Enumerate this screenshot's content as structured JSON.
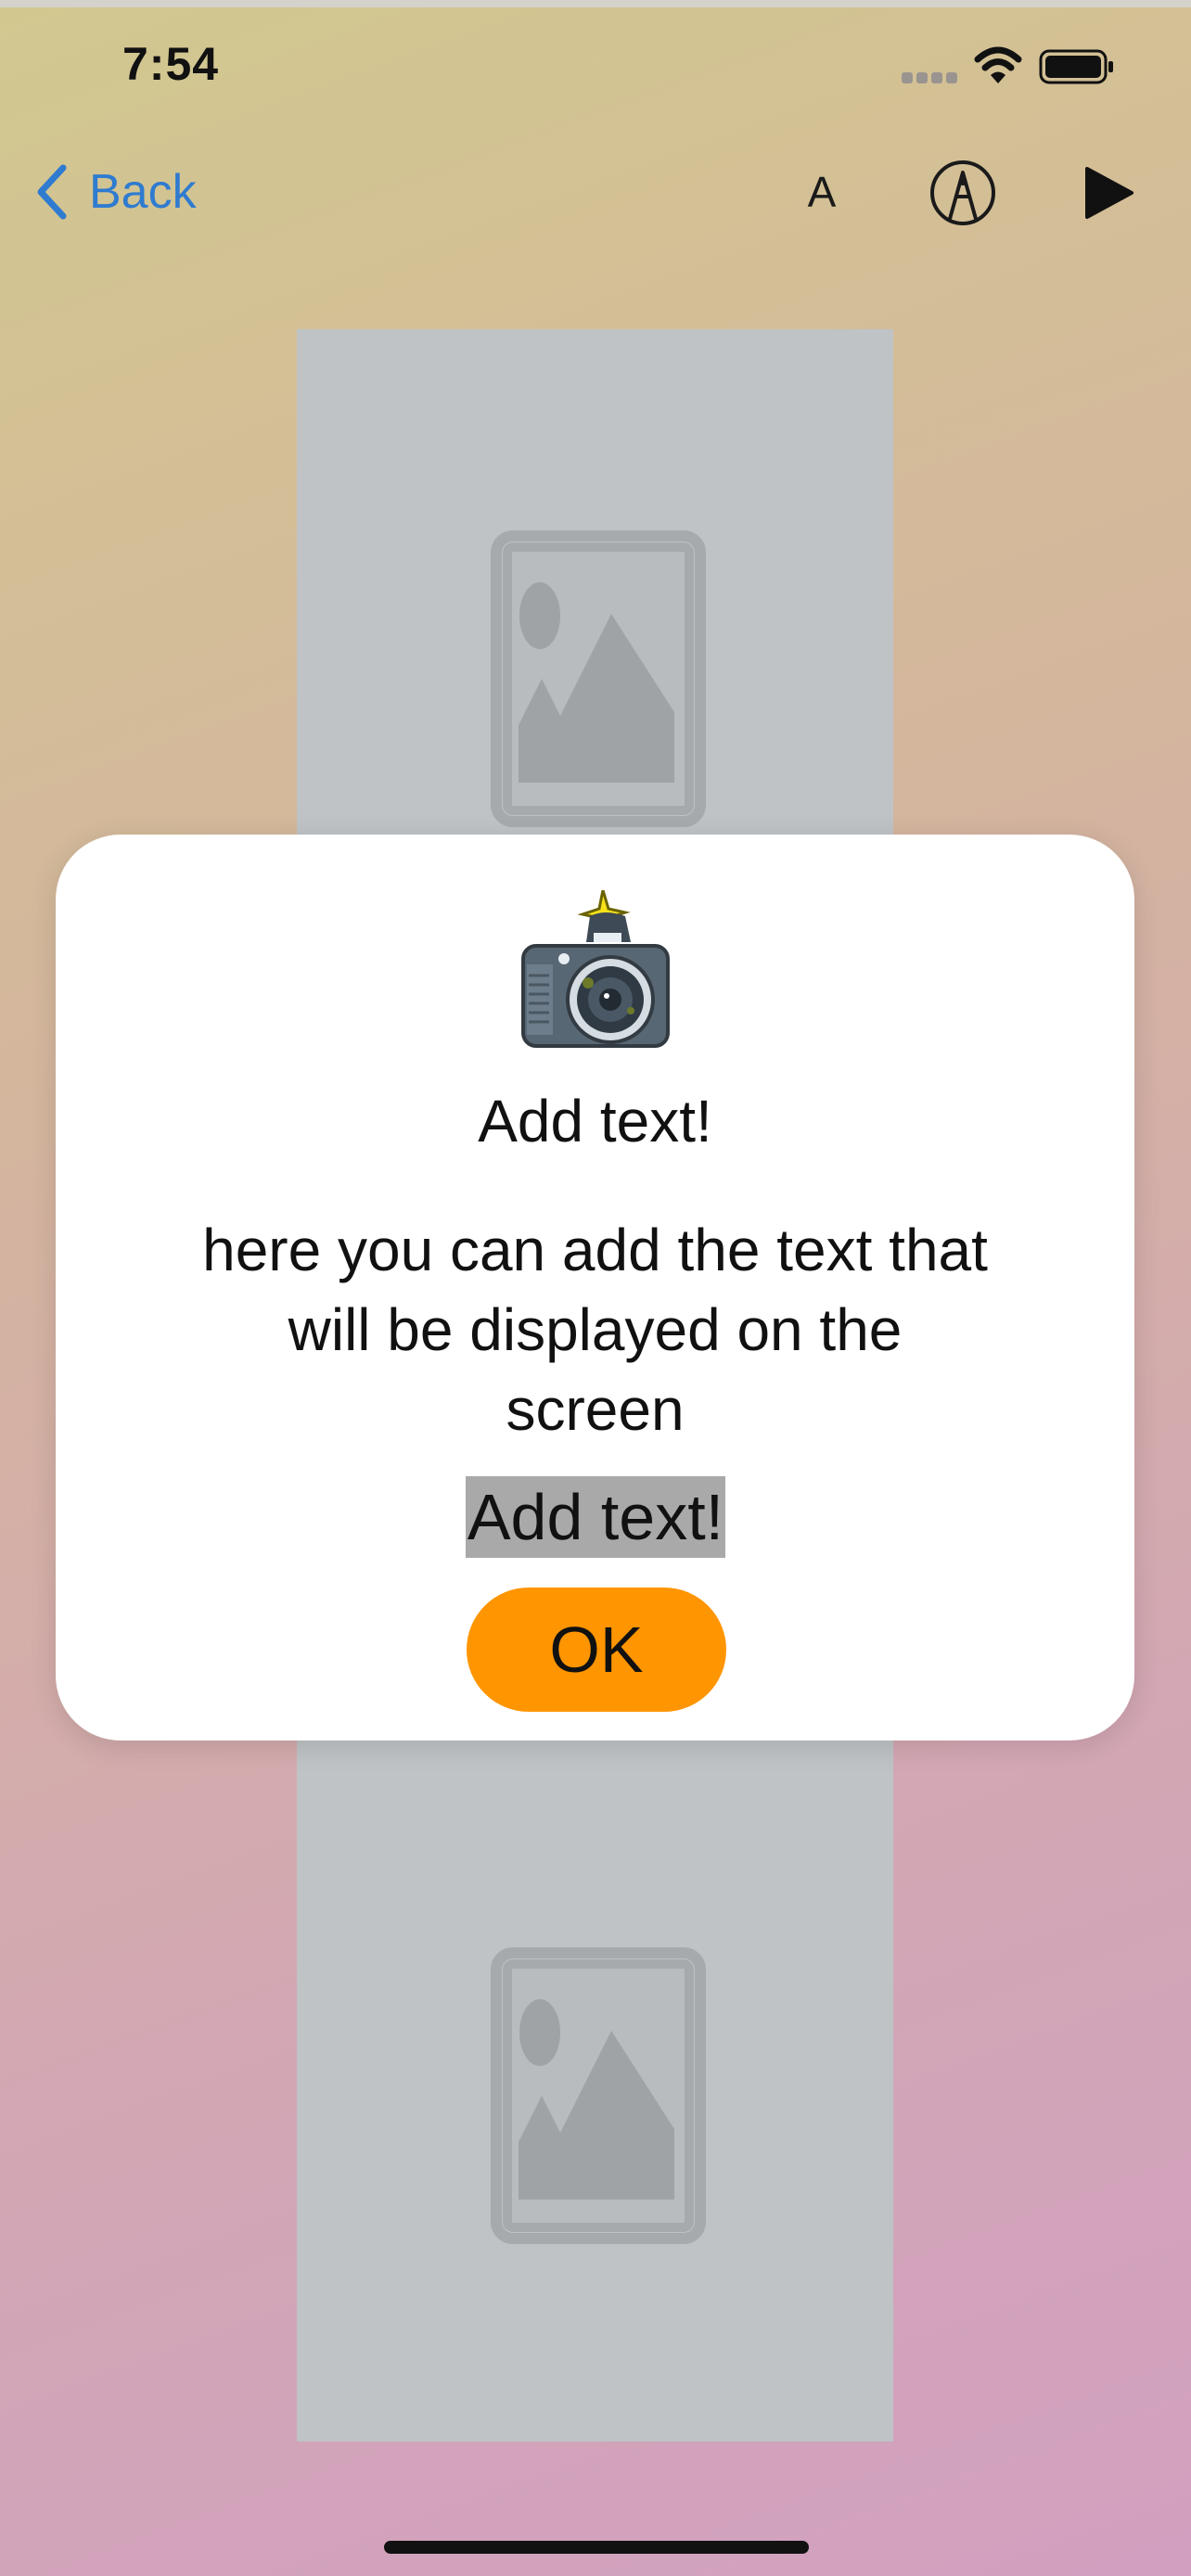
{
  "status_bar": {
    "time": "7:54",
    "icons": [
      "cellular-signal-icon",
      "wifi-icon",
      "battery-icon"
    ]
  },
  "nav": {
    "back_label": "Back",
    "font_button_label": "A",
    "icons": [
      "chevron-left-icon",
      "pen-circle-icon",
      "play-icon"
    ],
    "accent_color": "#2f7bd0"
  },
  "canvas": {
    "placeholders": [
      "image-placeholder-icon",
      "image-placeholder-icon"
    ],
    "column_color": "#bfc3c5"
  },
  "dialog": {
    "icon": "camera-icon",
    "title": "Add text!",
    "message": "here you can add the text that will be displayed on the screen",
    "field_value": "Add text!",
    "ok_label": "OK",
    "ok_color": "#ff9500"
  }
}
